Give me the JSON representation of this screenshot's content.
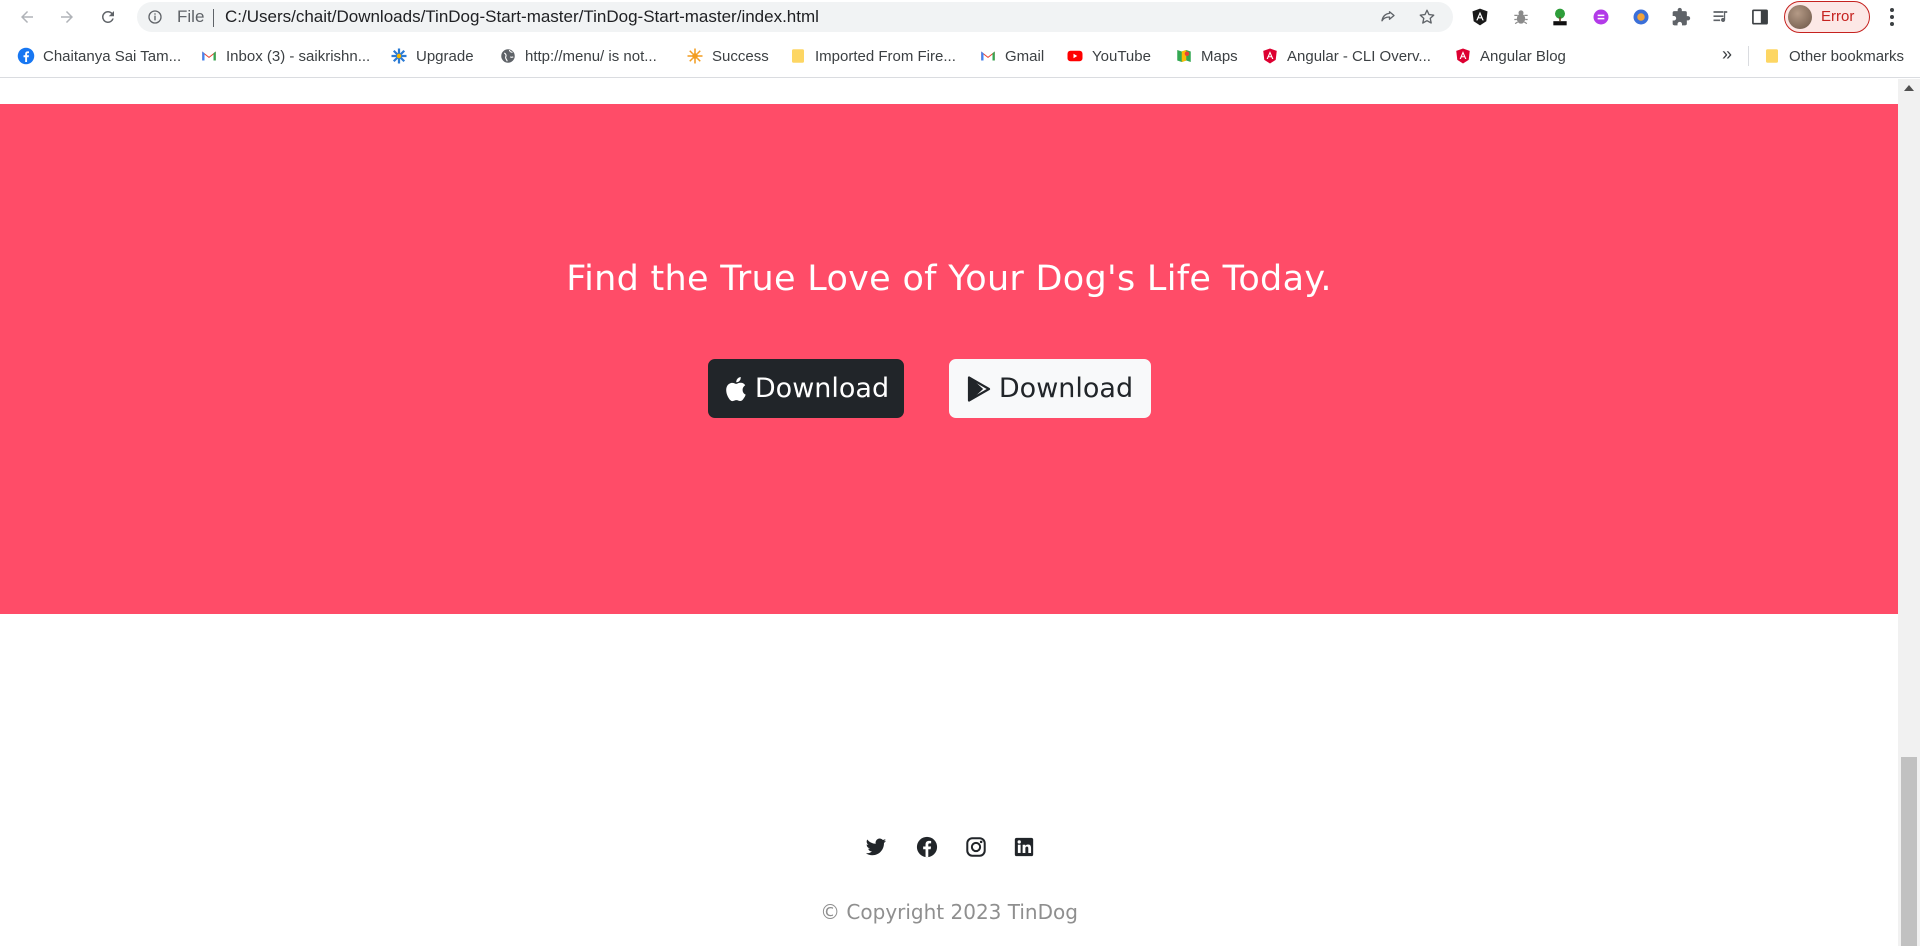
{
  "browser": {
    "omnibox": {
      "scheme_label": "File",
      "url": "C:/Users/chait/Downloads/TinDog-Start-master/TinDog-Start-master/index.html"
    },
    "profile": {
      "label": "Error",
      "status_color": "#c5221f"
    },
    "bookmarks": [
      {
        "label": "Chaitanya Sai Tam...",
        "icon": "facebook-icon"
      },
      {
        "label": "Inbox (3) - saikrishn...",
        "icon": "gmail-icon"
      },
      {
        "label": "Upgrade",
        "icon": "upgrade-icon"
      },
      {
        "label": "http://menu/ is not...",
        "icon": "globe-icon"
      },
      {
        "label": "Success",
        "icon": "success-icon"
      },
      {
        "label": "Imported From Fire...",
        "icon": "folder-icon"
      },
      {
        "label": "Gmail",
        "icon": "gmail-icon"
      },
      {
        "label": "YouTube",
        "icon": "youtube-icon"
      },
      {
        "label": "Maps",
        "icon": "maps-icon"
      },
      {
        "label": "Angular - CLI Overv...",
        "icon": "angular-icon"
      },
      {
        "label": "Angular Blog",
        "icon": "angular-icon"
      }
    ],
    "bookmarks_more": "»",
    "other_bookmarks": "Other bookmarks"
  },
  "page": {
    "cta": {
      "title": "Find the True Love of Your Dog's Life Today.",
      "background": "#ff4c68",
      "apple_button": {
        "label": "Download",
        "icon": "apple-icon"
      },
      "google_button": {
        "label": "Download",
        "icon": "google-play-icon"
      }
    },
    "footer": {
      "social_icons": [
        "twitter-icon",
        "facebook-icon",
        "instagram-icon",
        "linkedin-icon"
      ],
      "copyright": "© Copyright 2023 TinDog"
    }
  },
  "colors": {
    "accent": "#ff4c68",
    "dark_button": "#212529",
    "light_button": "#f8f9fa"
  }
}
